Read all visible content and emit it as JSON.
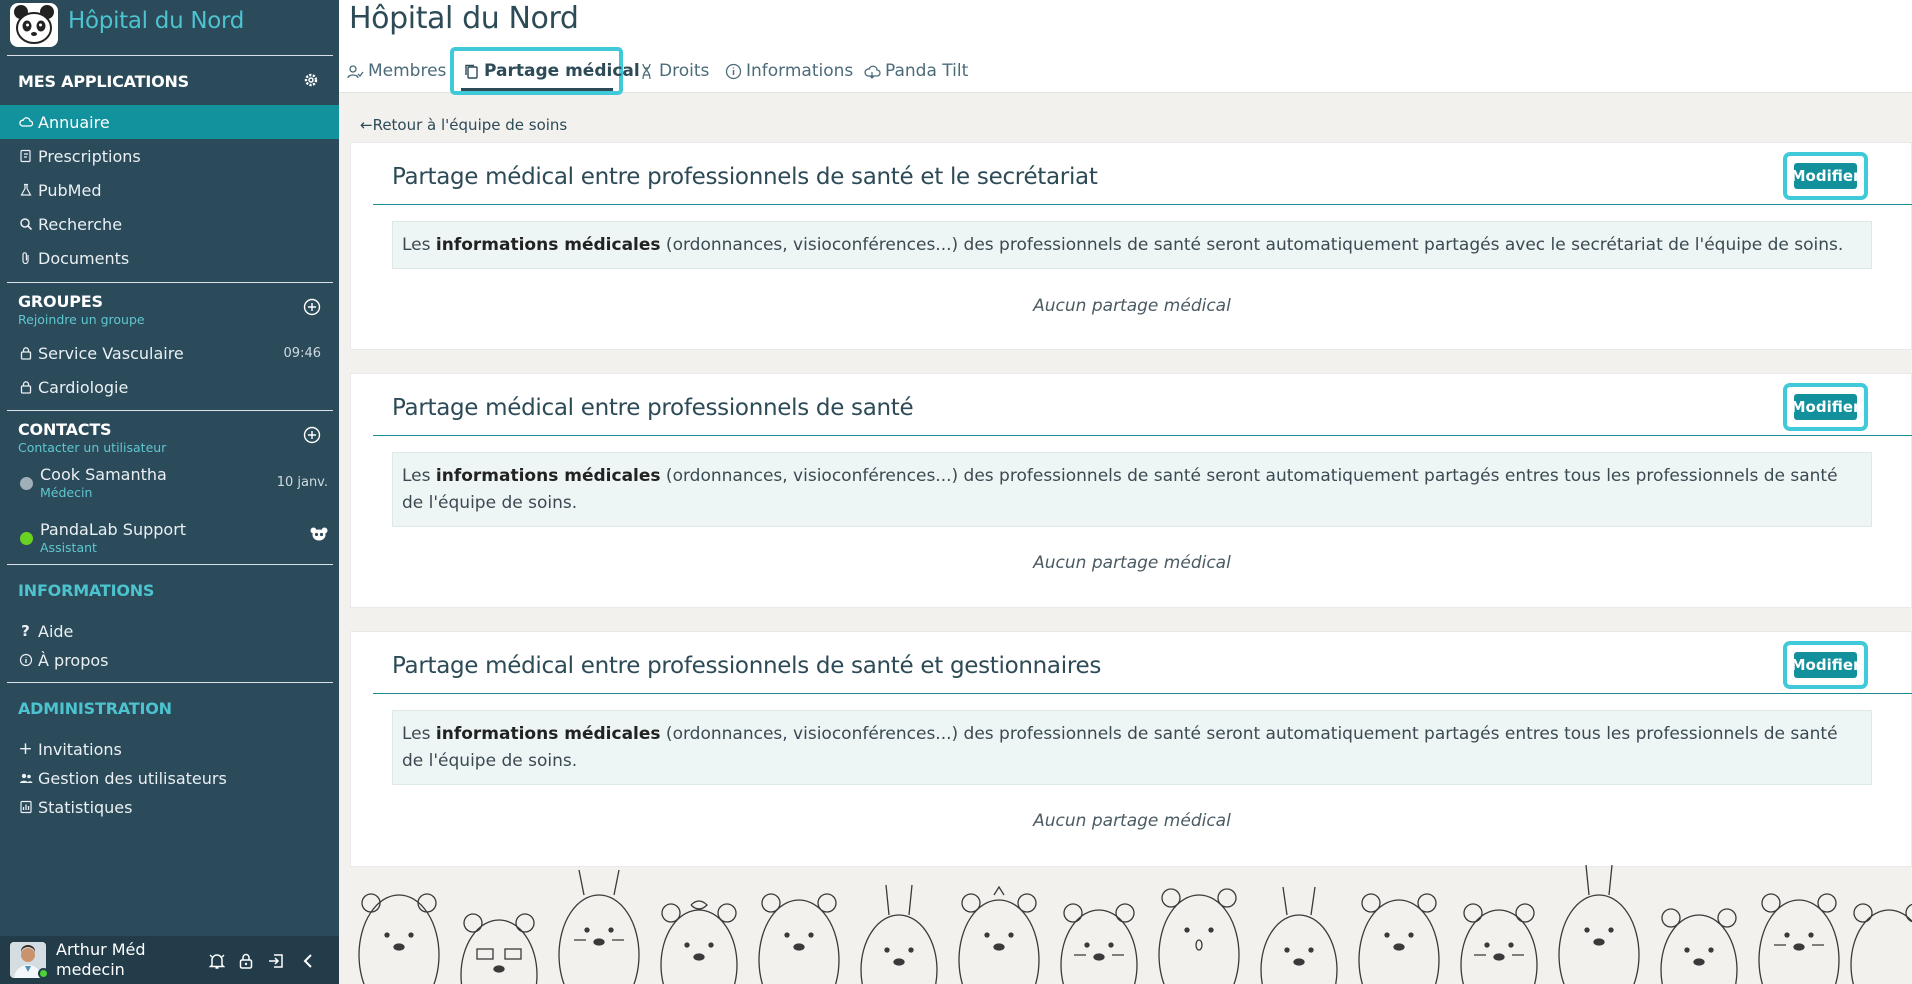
{
  "app": {
    "title": "Hôpital du Nord"
  },
  "sidebar": {
    "apps_title": "MES APPLICATIONS",
    "apps": [
      {
        "label": "Annuaire",
        "icon": "cloud-icon",
        "active": true
      },
      {
        "label": "Prescriptions",
        "icon": "prescription-icon"
      },
      {
        "label": "PubMed",
        "icon": "flask-icon"
      },
      {
        "label": "Recherche",
        "icon": "search-icon"
      },
      {
        "label": "Documents",
        "icon": "paperclip-icon"
      }
    ],
    "groups_title": "GROUPES",
    "groups_sub": "Rejoindre un groupe",
    "groups": [
      {
        "label": "Service Vasculaire",
        "time": "09:46"
      },
      {
        "label": "Cardiologie",
        "time": ""
      }
    ],
    "contacts_title": "CONTACTS",
    "contacts_sub": "Contacter un utilisateur",
    "contacts": [
      {
        "name": "Cook Samantha",
        "role": "Médecin",
        "time": "10 janv.",
        "status_color": "#9fb0b8"
      },
      {
        "name": "PandaLab Support",
        "role": "Assistant",
        "time": "",
        "status_color": "#6ad321"
      }
    ],
    "info_title": "INFORMATIONS",
    "info_items": [
      {
        "label": "Aide",
        "icon": "question-icon"
      },
      {
        "label": "À propos",
        "icon": "info-icon"
      }
    ],
    "admin_title": "ADMINISTRATION",
    "admin_items": [
      {
        "label": "Invitations",
        "icon": "plus-icon"
      },
      {
        "label": "Gestion des utilisateurs",
        "icon": "users-icon"
      },
      {
        "label": "Statistiques",
        "icon": "stats-icon"
      }
    ]
  },
  "user": {
    "name": "Arthur Méd",
    "role": "medecin"
  },
  "main": {
    "title": "Hôpital du Nord",
    "tabs": [
      {
        "label": "Membres",
        "icon": "members-icon"
      },
      {
        "label": "Partage médical",
        "icon": "copy-icon",
        "active": true
      },
      {
        "label": "Droits",
        "icon": "dna-icon"
      },
      {
        "label": "Informations",
        "icon": "info-icon"
      },
      {
        "label": "Panda Tilt",
        "icon": "cloud-icon"
      }
    ],
    "back_link": "Retour à l'équipe de soins",
    "modify_label": "Modifier",
    "info_bold": "informations médicales",
    "info_prefix": "Les ",
    "cards": [
      {
        "title": "Partage médical entre professionnels de santé et le secrétariat",
        "info_rest": " (ordonnances, visioconférences...) des professionnels de santé seront automatiquement partagés avec le secrétariat de l'équipe de soins.",
        "empty": "Aucun partage médical"
      },
      {
        "title": "Partage médical entre professionnels de santé",
        "info_rest": " (ordonnances, visioconférences...) des professionnels de santé seront automatiquement partagés entres tous les professionnels de santé de l'équipe de soins.",
        "empty": "Aucun partage médical"
      },
      {
        "title": "Partage médical entre professionnels de santé et gestionnaires",
        "info_rest": " (ordonnances, visioconférences...) des professionnels de santé seront automatiquement partagés entres tous les professionnels de santé de l'équipe de soins.",
        "empty": "Aucun partage médical"
      }
    ]
  }
}
